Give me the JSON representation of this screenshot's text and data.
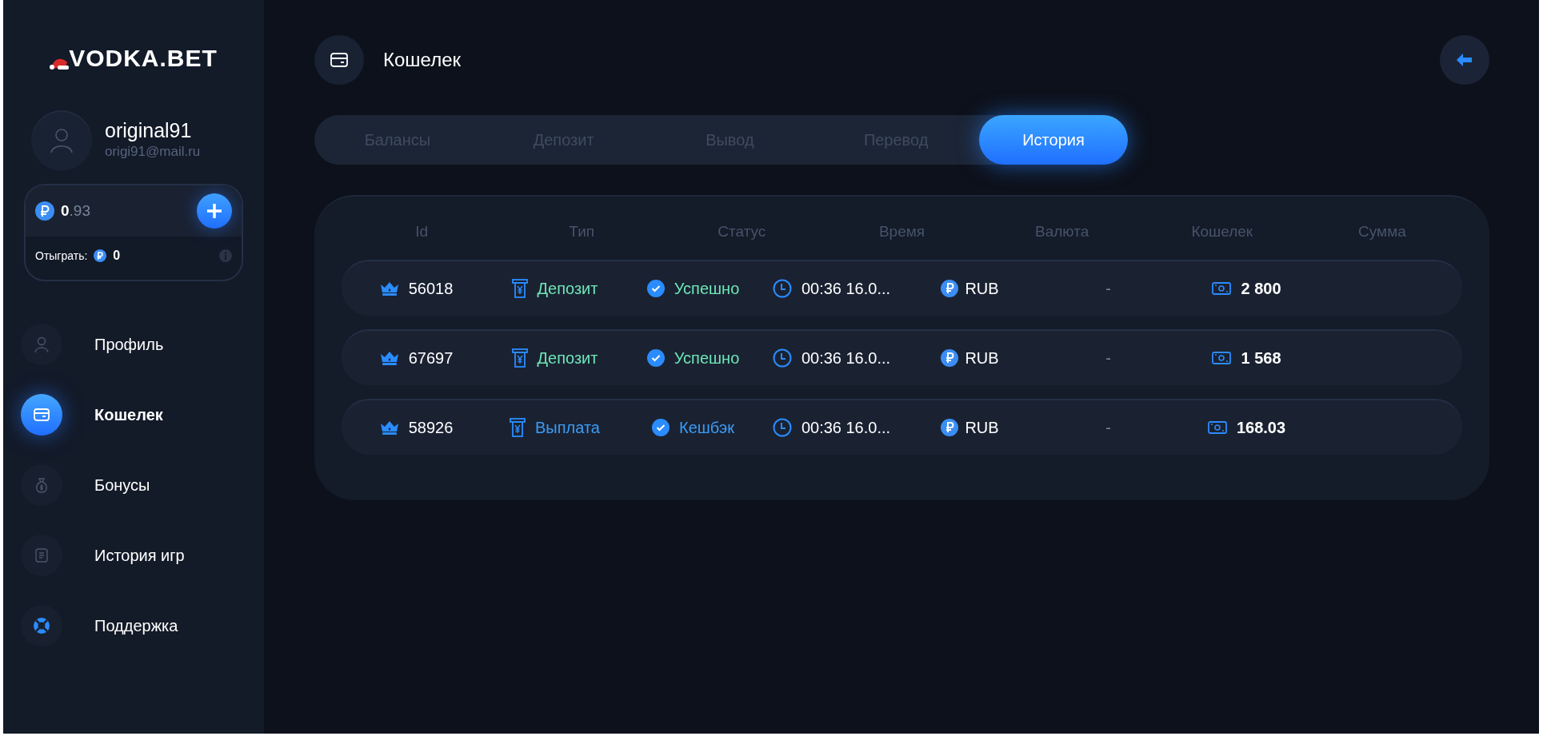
{
  "logo": "VODKA.BET",
  "user": {
    "name": "original91",
    "email": "origi91@mail.ru"
  },
  "balance": {
    "amount": "**0**.93",
    "wager_label": "Отыграть:",
    "wager_value": "0"
  },
  "nav": [
    {
      "label": "Профиль",
      "selected": false
    },
    {
      "label": "Кошелек",
      "selected": true
    },
    {
      "label": "Бонусы",
      "selected": false
    },
    {
      "label": "История игр",
      "selected": false
    },
    {
      "label": "Поддержка",
      "selected": false
    }
  ],
  "page_title": "Кошелек",
  "tabs": [
    {
      "label": "Балансы",
      "selected": false
    },
    {
      "label": "Депозит",
      "selected": false
    },
    {
      "label": "Вывод",
      "selected": false
    },
    {
      "label": "Перевод",
      "selected": false
    },
    {
      "label": "История",
      "selected": true
    }
  ],
  "table": {
    "columns": [
      "Id",
      "Тип",
      "Статус",
      "Время",
      "Валюта",
      "Кошелек",
      "Сумма"
    ],
    "rows": [
      {
        "id": "56018",
        "type": {
          "label": "Депозит",
          "color": "#6ee7b7"
        },
        "status": {
          "label": "Успешно",
          "color": "#6ee7b7"
        },
        "time": "00:36 16.0...",
        "currency": "RUB",
        "wallet": "-",
        "amount": "2 800"
      },
      {
        "id": "67697",
        "type": {
          "label": "Депозит",
          "color": "#6ee7b7"
        },
        "status": {
          "label": "Успешно",
          "color": "#6ee7b7"
        },
        "time": "00:36 16.0...",
        "currency": "RUB",
        "wallet": "-",
        "amount": "1 568"
      },
      {
        "id": "58926",
        "type": {
          "label": "Выплата",
          "color": "#3b9cf5"
        },
        "status": {
          "label": "Кешбэк",
          "color": "#3b9cf5"
        },
        "time": "00:36 16.0...",
        "currency": "RUB",
        "wallet": "-",
        "amount": "168.03"
      }
    ]
  }
}
